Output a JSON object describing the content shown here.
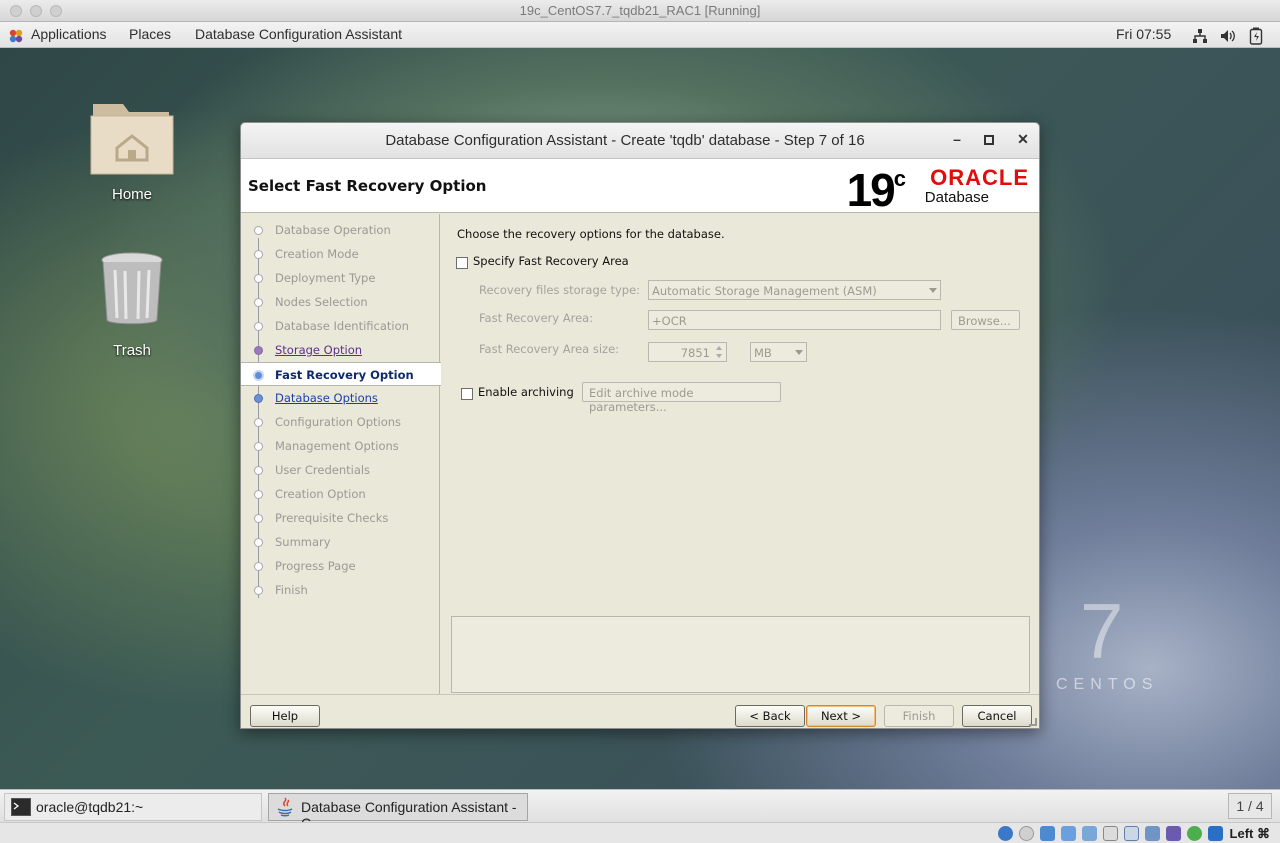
{
  "vbox": {
    "title": "19c_CentOS7.7_tqdb21_RAC1 [Running]"
  },
  "panel": {
    "applications": "Applications",
    "places": "Places",
    "active_app": "Database Configuration Assistant",
    "clock": "Fri 07:55"
  },
  "desktop": {
    "icons": [
      {
        "label": "Home"
      },
      {
        "label": "Trash"
      }
    ],
    "brand_number": "7",
    "brand_word": "CENTOS"
  },
  "dialog": {
    "title": "Database Configuration Assistant - Create 'tqdb' database - Step 7 of 16",
    "heading": "Select Fast Recovery Option",
    "logo": {
      "version": "19",
      "version_sup": "c",
      "vendor": "ORACLE",
      "product": "Database"
    },
    "steps": [
      {
        "label": "Database Operation",
        "state": "disabled"
      },
      {
        "label": "Creation Mode",
        "state": "disabled"
      },
      {
        "label": "Deployment Type",
        "state": "disabled"
      },
      {
        "label": "Nodes Selection",
        "state": "disabled"
      },
      {
        "label": "Database Identification",
        "state": "disabled"
      },
      {
        "label": "Storage Option",
        "state": "done"
      },
      {
        "label": "Fast Recovery Option",
        "state": "current"
      },
      {
        "label": "Database Options",
        "state": "next"
      },
      {
        "label": "Configuration Options",
        "state": "disabled"
      },
      {
        "label": "Management Options",
        "state": "disabled"
      },
      {
        "label": "User Credentials",
        "state": "disabled"
      },
      {
        "label": "Creation Option",
        "state": "disabled"
      },
      {
        "label": "Prerequisite Checks",
        "state": "disabled"
      },
      {
        "label": "Summary",
        "state": "disabled"
      },
      {
        "label": "Progress Page",
        "state": "disabled"
      },
      {
        "label": "Finish",
        "state": "disabled"
      }
    ],
    "content": {
      "intro": "Choose the recovery options for the database.",
      "specify_fra_label": "Specify Fast Recovery Area",
      "specify_fra_checked": false,
      "storage_type_label": "Recovery files storage type:",
      "storage_type_value": "Automatic Storage Management (ASM)",
      "fra_label": "Fast Recovery Area:",
      "fra_value": "+OCR",
      "browse_label": "Browse...",
      "fra_size_label": "Fast Recovery Area size:",
      "fra_size_value": "7851",
      "fra_size_unit": "MB",
      "archiving_label": "Enable archiving",
      "archiving_checked": false,
      "archive_params_label": "Edit archive mode parameters..."
    },
    "buttons": {
      "help": "Help",
      "back": "< Back",
      "next": "Next >",
      "finish": "Finish",
      "cancel": "Cancel"
    }
  },
  "taskbar": {
    "tasks": [
      {
        "label": "oracle@tqdb21:~"
      },
      {
        "label": "Database Configuration Assistant - C..."
      }
    ],
    "workspace": "1 / 4"
  },
  "statusbar": {
    "host_key": "Left ⌘"
  }
}
